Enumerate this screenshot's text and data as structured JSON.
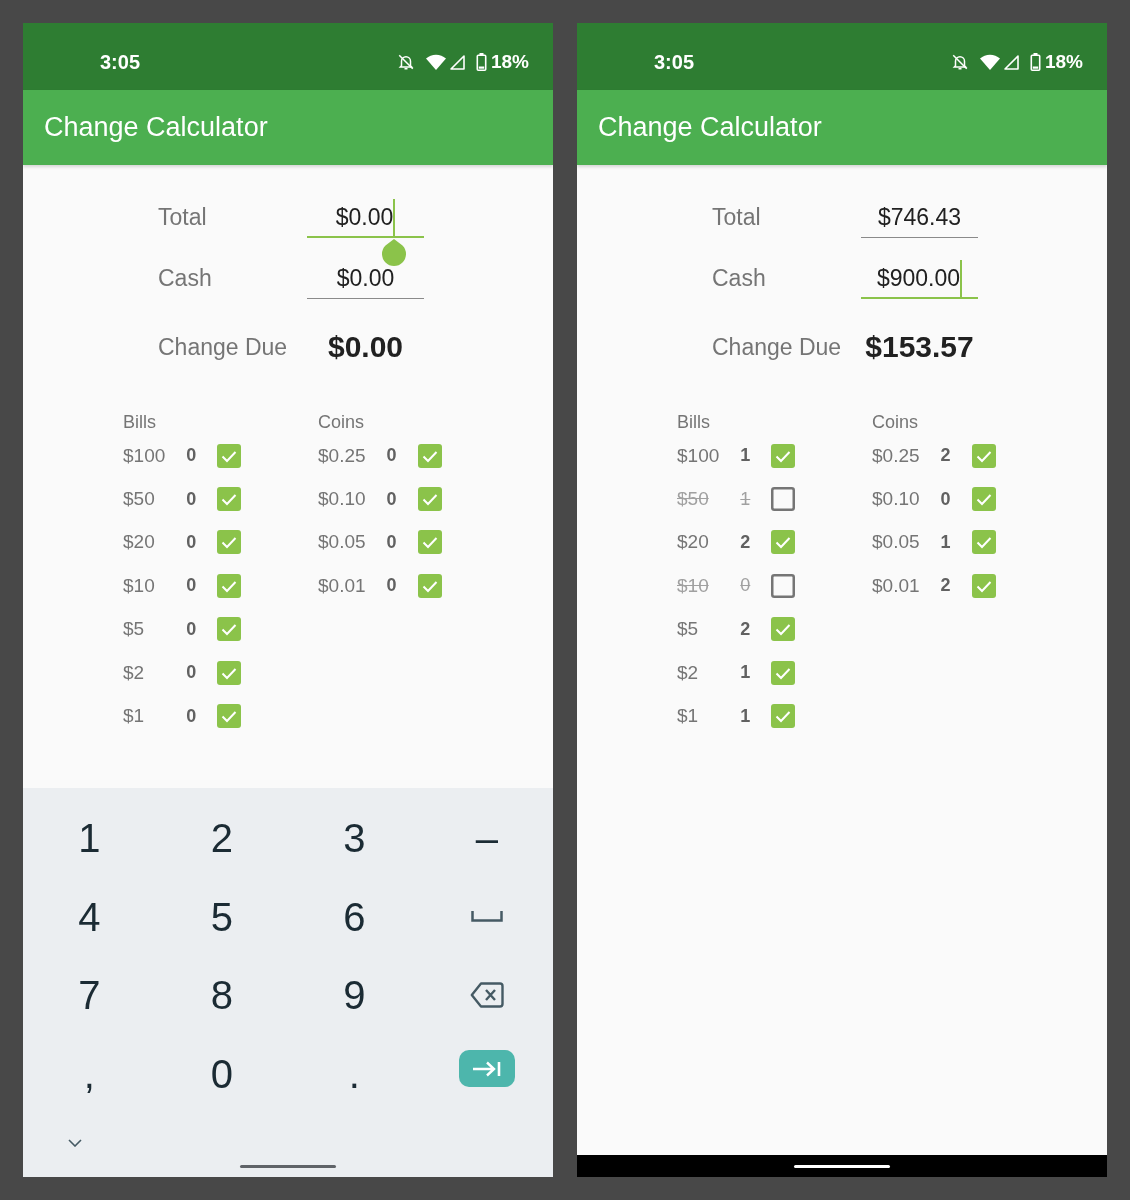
{
  "phones": [
    {
      "status_bar": {
        "time": "3:05",
        "battery": "18%"
      },
      "app_bar": {
        "title": "Change Calculator"
      },
      "fields": [
        {
          "label": "Total",
          "value": "$0.00",
          "focused": true,
          "handle": true
        },
        {
          "label": "Cash",
          "value": "$0.00",
          "focused": false,
          "handle": false
        }
      ],
      "change_due": {
        "label": "Change Due",
        "value": "$0.00"
      },
      "groups": [
        {
          "title": "Bills",
          "items": [
            {
              "denomination": "$100",
              "count": "0",
              "checked": true
            },
            {
              "denomination": "$50",
              "count": "0",
              "checked": true
            },
            {
              "denomination": "$20",
              "count": "0",
              "checked": true
            },
            {
              "denomination": "$10",
              "count": "0",
              "checked": true
            },
            {
              "denomination": "$5",
              "count": "0",
              "checked": true
            },
            {
              "denomination": "$2",
              "count": "0",
              "checked": true
            },
            {
              "denomination": "$1",
              "count": "0",
              "checked": true
            }
          ]
        },
        {
          "title": "Coins",
          "items": [
            {
              "denomination": "$0.25",
              "count": "0",
              "checked": true
            },
            {
              "denomination": "$0.10",
              "count": "0",
              "checked": true
            },
            {
              "denomination": "$0.05",
              "count": "0",
              "checked": true
            },
            {
              "denomination": "$0.01",
              "count": "0",
              "checked": true
            }
          ]
        }
      ],
      "keyboard": {
        "keys": [
          {
            "kind": "char",
            "label": "1"
          },
          {
            "kind": "char",
            "label": "2"
          },
          {
            "kind": "char",
            "label": "3"
          },
          {
            "kind": "char",
            "label": "–"
          },
          {
            "kind": "char",
            "label": "4"
          },
          {
            "kind": "char",
            "label": "5"
          },
          {
            "kind": "char",
            "label": "6"
          },
          {
            "kind": "space"
          },
          {
            "kind": "char",
            "label": "7"
          },
          {
            "kind": "char",
            "label": "8"
          },
          {
            "kind": "char",
            "label": "9"
          },
          {
            "kind": "backspace"
          },
          {
            "kind": "char",
            "label": ","
          },
          {
            "kind": "char",
            "label": "0"
          },
          {
            "kind": "char",
            "label": "."
          },
          {
            "kind": "enter"
          }
        ]
      }
    },
    {
      "status_bar": {
        "time": "3:05",
        "battery": "18%"
      },
      "app_bar": {
        "title": "Change Calculator"
      },
      "fields": [
        {
          "label": "Total",
          "value": "$746.43",
          "focused": false,
          "handle": false
        },
        {
          "label": "Cash",
          "value": "$900.00",
          "focused": true,
          "handle": false
        }
      ],
      "change_due": {
        "label": "Change Due",
        "value": "$153.57"
      },
      "groups": [
        {
          "title": "Bills",
          "items": [
            {
              "denomination": "$100",
              "count": "1",
              "checked": true
            },
            {
              "denomination": "$50",
              "count": "1",
              "checked": false
            },
            {
              "denomination": "$20",
              "count": "2",
              "checked": true
            },
            {
              "denomination": "$10",
              "count": "0",
              "checked": false
            },
            {
              "denomination": "$5",
              "count": "2",
              "checked": true
            },
            {
              "denomination": "$2",
              "count": "1",
              "checked": true
            },
            {
              "denomination": "$1",
              "count": "1",
              "checked": true
            }
          ]
        },
        {
          "title": "Coins",
          "items": [
            {
              "denomination": "$0.25",
              "count": "2",
              "checked": true
            },
            {
              "denomination": "$0.10",
              "count": "0",
              "checked": true
            },
            {
              "denomination": "$0.05",
              "count": "1",
              "checked": true
            },
            {
              "denomination": "$0.01",
              "count": "2",
              "checked": true
            }
          ]
        }
      ]
    }
  ]
}
